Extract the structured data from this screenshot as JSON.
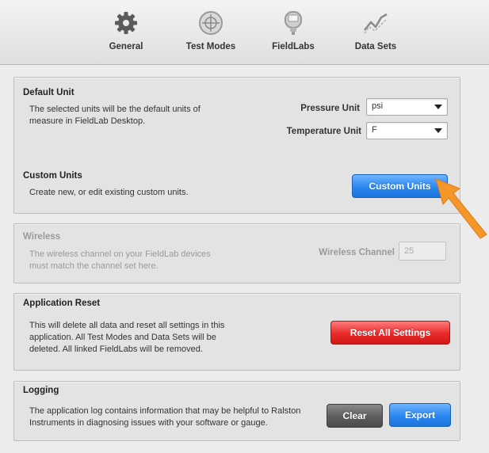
{
  "toolbar": {
    "items": [
      {
        "label": "General",
        "icon": "gear-icon"
      },
      {
        "label": "Test Modes",
        "icon": "crosshair-icon"
      },
      {
        "label": "FieldLabs",
        "icon": "gauge-device-icon"
      },
      {
        "label": "Data Sets",
        "icon": "line-chart-icon"
      }
    ]
  },
  "default_unit": {
    "title": "Default Unit",
    "description": "The selected units will be the default units of measure in FieldLab Desktop.",
    "pressure_label": "Pressure Unit",
    "pressure_value": "psi",
    "temperature_label": "Temperature Unit",
    "temperature_value": "F",
    "custom_title": "Custom Units",
    "custom_description": "Create new, or edit existing custom units.",
    "custom_button": "Custom Units"
  },
  "wireless": {
    "title": "Wireless",
    "description": "The wireless channel on your FieldLab devices must match the channel set here.",
    "channel_label": "Wireless Channel",
    "channel_value": "25"
  },
  "reset": {
    "title": "Application Reset",
    "description": "This will delete all data and reset all settings in this application. All Test Modes and Data Sets will be deleted. All linked FieldLabs will be removed.",
    "button": "Reset All Settings"
  },
  "logging": {
    "title": "Logging",
    "description": "The application log contains information that may be helpful to Ralston Instruments in diagnosing issues with your software or gauge.",
    "clear_button": "Clear",
    "export_button": "Export"
  },
  "colors": {
    "accent_blue": "#2a86f0",
    "danger_red": "#e82a2a",
    "pointer_orange": "#f5962a"
  }
}
